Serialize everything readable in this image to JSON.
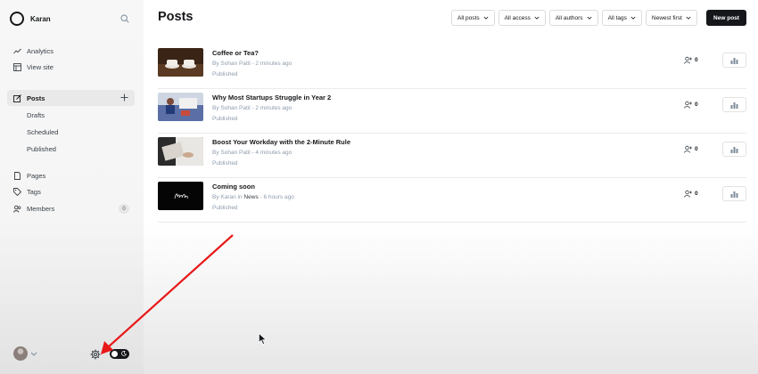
{
  "sidebar": {
    "site_name": "Karan",
    "nav": {
      "analytics": "Analytics",
      "view_site": "View site",
      "posts": "Posts",
      "drafts": "Drafts",
      "scheduled": "Scheduled",
      "published": "Published",
      "pages": "Pages",
      "tags": "Tags",
      "members": "Members",
      "members_count": "0"
    }
  },
  "header": {
    "title": "Posts",
    "filters": {
      "posts": "All posts",
      "access": "All access",
      "authors": "All authors",
      "tags": "All tags",
      "sort": "Newest first"
    },
    "new_post": "New post"
  },
  "posts": [
    {
      "title": "Coffee or Tea?",
      "by": "By",
      "author": "Sohan Patil",
      "meta": " - 2 minutes ago",
      "status": "Published",
      "members": "0"
    },
    {
      "title": "Why Most Startups Struggle in Year 2",
      "by": "By",
      "author": "Sohan Patil",
      "meta": " - 2 minutes ago",
      "status": "Published",
      "members": "0"
    },
    {
      "title": "Boost Your Workday with the 2-Minute Rule",
      "by": "By",
      "author": "Sohan Patil",
      "meta": " - 4 minutes ago",
      "status": "Published",
      "members": "0"
    },
    {
      "title": "Coming soon",
      "by": "By",
      "author": "Karan",
      "in": " in ",
      "tag": "News",
      "meta": " - 6 hours ago",
      "status": "Published",
      "members": "0"
    }
  ],
  "colors": {
    "accent_dark": "#15171a",
    "meta_gray": "#8e9cac",
    "annotation_arrow": "#e81818"
  }
}
